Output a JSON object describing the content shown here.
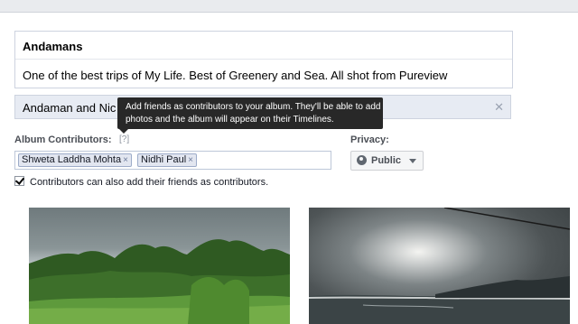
{
  "album": {
    "title": "Andamans",
    "description": "One of the best trips of My Life.  Best of Greenery and Sea. All shot from Pureview"
  },
  "location": {
    "value": "Andaman and Nic",
    "clear_icon": "close-icon"
  },
  "tooltip": {
    "line1": "Add friends as contributors to your album. They'll be able to add",
    "line2": "photos and the album will appear on their Timelines."
  },
  "contributors": {
    "label": "Album Contributors:",
    "help": "[?]",
    "tokens": [
      {
        "name": "Shweta Laddha Mohta"
      },
      {
        "name": "Nidhi Paul"
      }
    ],
    "remove_glyph": "×"
  },
  "privacy": {
    "label": "Privacy:",
    "value": "Public",
    "icon": "globe-icon"
  },
  "permission": {
    "checked": true,
    "label": "Contributors can also add their friends as contributors."
  },
  "photos": [
    {
      "subject": "green forest under cloudy sky"
    },
    {
      "subject": "sunlight through clouds over sea"
    }
  ],
  "colors": {
    "field_highlight": "#e7ebf3",
    "tooltip_bg": "#282828",
    "token_bg": "#e2e6f0",
    "token_border": "#9dacc9"
  }
}
